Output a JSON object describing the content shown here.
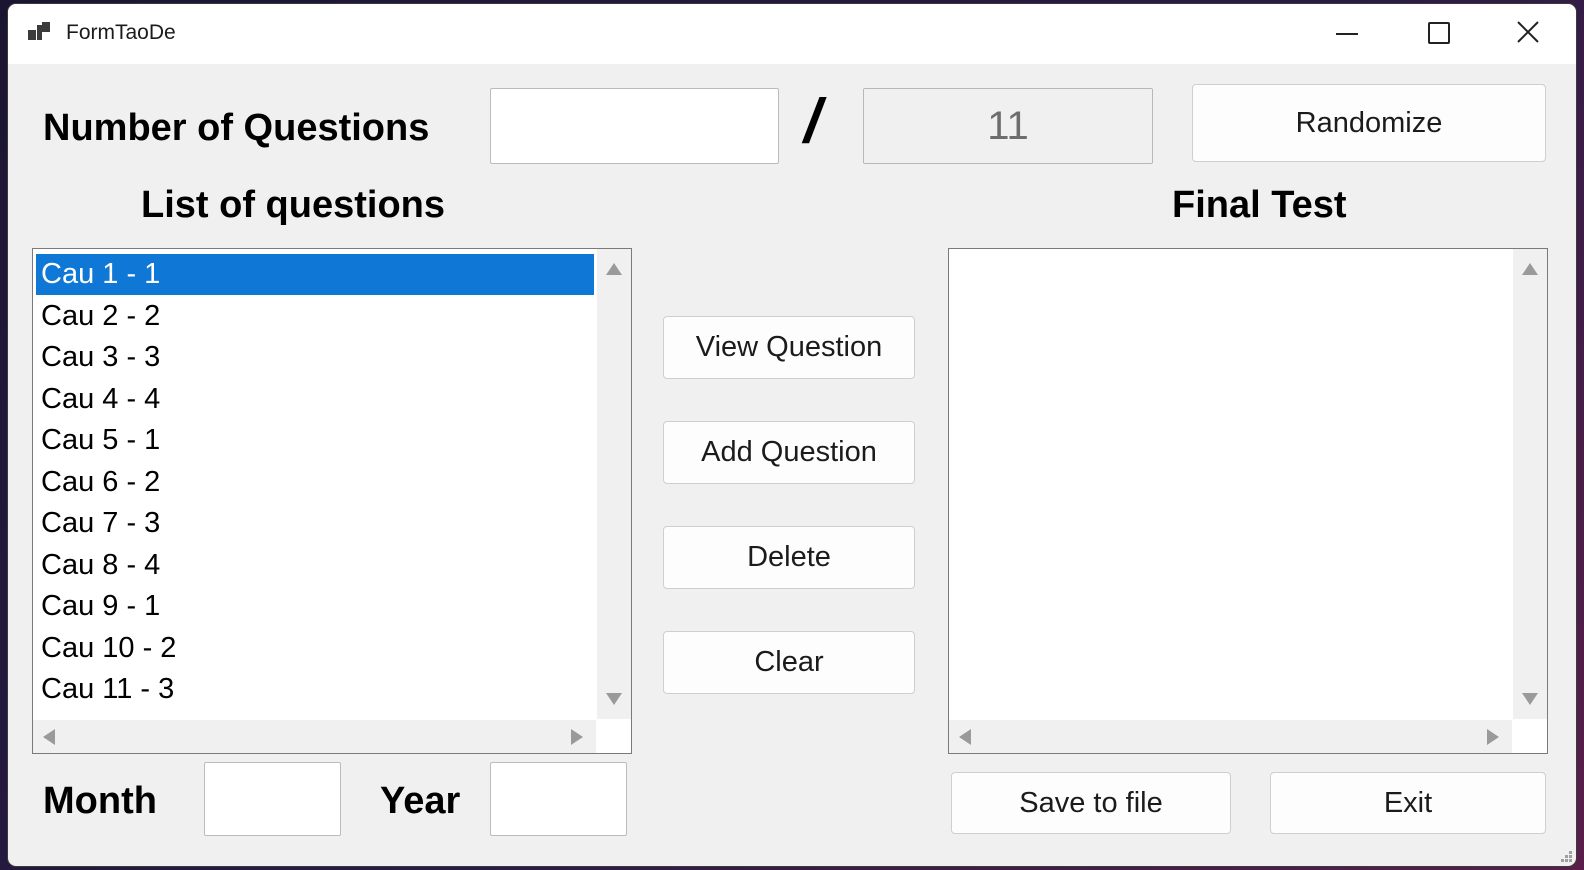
{
  "window": {
    "title": "FormTaoDe",
    "app_icon": "form-icon",
    "controls": [
      "minimize-icon",
      "maximize-icon",
      "close-icon"
    ]
  },
  "top": {
    "number_label": "Number of Questions",
    "number_value": "",
    "separator": "/",
    "total_count": "11",
    "randomize_label": "Randomize"
  },
  "questions": {
    "heading": "List of questions",
    "items": [
      "Cau 1 - 1",
      "Cau 2 - 2",
      "Cau 3 - 3",
      "Cau 4 - 4",
      "Cau 5 - 1",
      "Cau 6 - 2",
      "Cau 7 - 3",
      "Cau 8 - 4",
      "Cau 9 - 1",
      "Cau 10 - 2",
      "Cau 11 - 3"
    ],
    "selected_index": 0
  },
  "actions": {
    "view": "View Question",
    "add": "Add Question",
    "delete": "Delete",
    "clear": "Clear"
  },
  "final_test": {
    "heading": "Final Test",
    "items": []
  },
  "bottom": {
    "month_label": "Month",
    "month_value": "",
    "year_label": "Year",
    "year_value": "",
    "save_label": "Save to file",
    "exit_label": "Exit"
  },
  "colors": {
    "selection": "#0f78d6",
    "window_bg": "#f0f0f0"
  }
}
